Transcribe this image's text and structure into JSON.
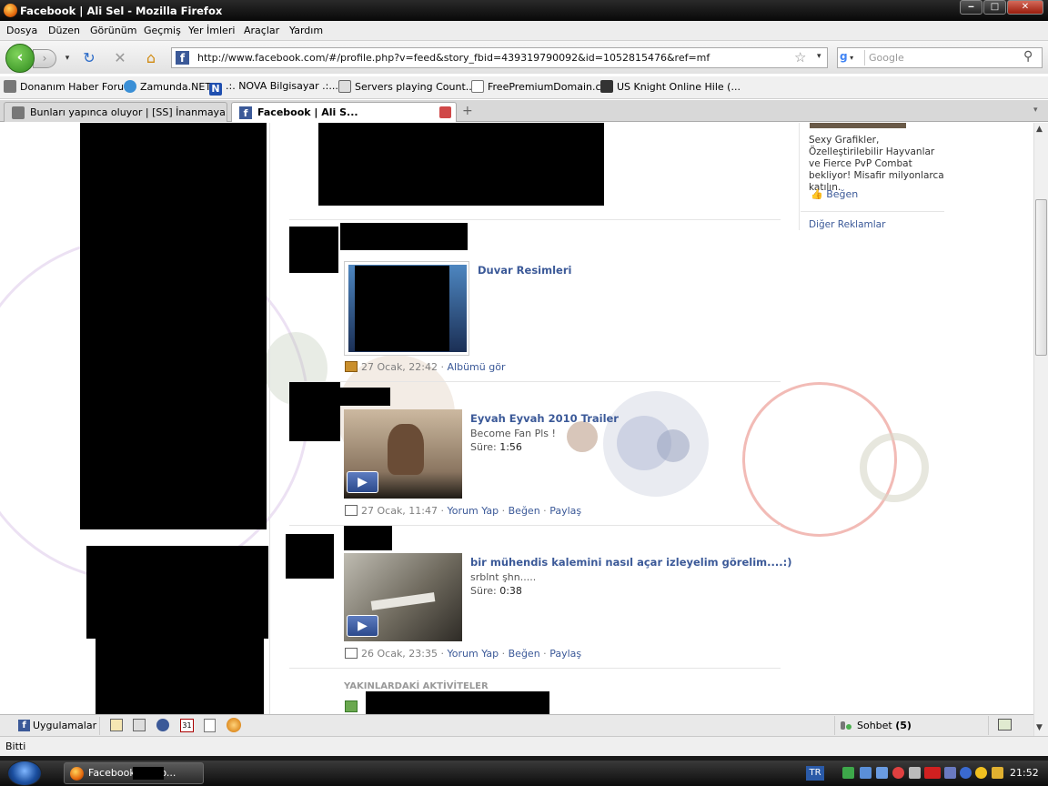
{
  "window": {
    "title": "Facebook | Ali Sel - Mozilla Firefox",
    "minimize": "‒",
    "maximize": "□",
    "close": "✕"
  },
  "menu": [
    "Dosya",
    "Düzen",
    "Görünüm",
    "Geçmiş",
    "Yer İmleri",
    "Araçlar",
    "Yardım"
  ],
  "address": {
    "url": "http://www.facebook.com/#/profile.php?v=feed&story_fbid=439319790092&id=1052815476&ref=mf"
  },
  "search": {
    "placeholder": "Google"
  },
  "bookmarks": [
    "Donanım Haber Forum",
    "Zamunda.NET",
    ".:. NOVA Bilgisayar .:...",
    "Servers playing Count...",
    "FreePremiumDomain.c...",
    "US Knight Online Hile (..."
  ],
  "tabs": [
    {
      "label": "Bunları yapınca oluyor | [SS] İnanmaya..."
    },
    {
      "label": "Facebook | Ali S..."
    }
  ],
  "ads": {
    "text": "Sexy Grafikler, Özelleştirilebilir Hayvanlar ve Fierce PvP Combat bekliyor! Misafir milyonlarca katılın.",
    "like": "Beğen",
    "more": "Diğer Reklamlar"
  },
  "feed": [
    {
      "title": "Duvar Resimleri",
      "time": "27 Ocak, 22:42",
      "link1": "Albümü gör"
    },
    {
      "title": "Eyvah Eyvah 2010 Trailer",
      "desc": "Become Fan Pls !",
      "duration_label": "Süre:",
      "duration": "1:56",
      "time": "27 Ocak, 11:47",
      "comment": "Yorum Yap",
      "like": "Beğen",
      "share": "Paylaş"
    },
    {
      "title": "bir mühendis kalemini nasıl açar izleyelim görelim....:)",
      "desc": "srblnt şhn.....",
      "duration_label": "Süre:",
      "duration": "0:38",
      "time": "26 Ocak, 23:35",
      "comment": "Yorum Yap",
      "like": "Beğen",
      "share": "Paylaş"
    }
  ],
  "recent_header": "YAKINLARDAKİ AKTİVİTELER",
  "fbbar": {
    "apps": "Uygulamalar",
    "chat": "Sohbet",
    "chat_count": "(5)"
  },
  "status": "Bitti",
  "taskbar": {
    "item": "Facebook |       - Mo...",
    "lang": "TR",
    "clock": "21:52"
  }
}
